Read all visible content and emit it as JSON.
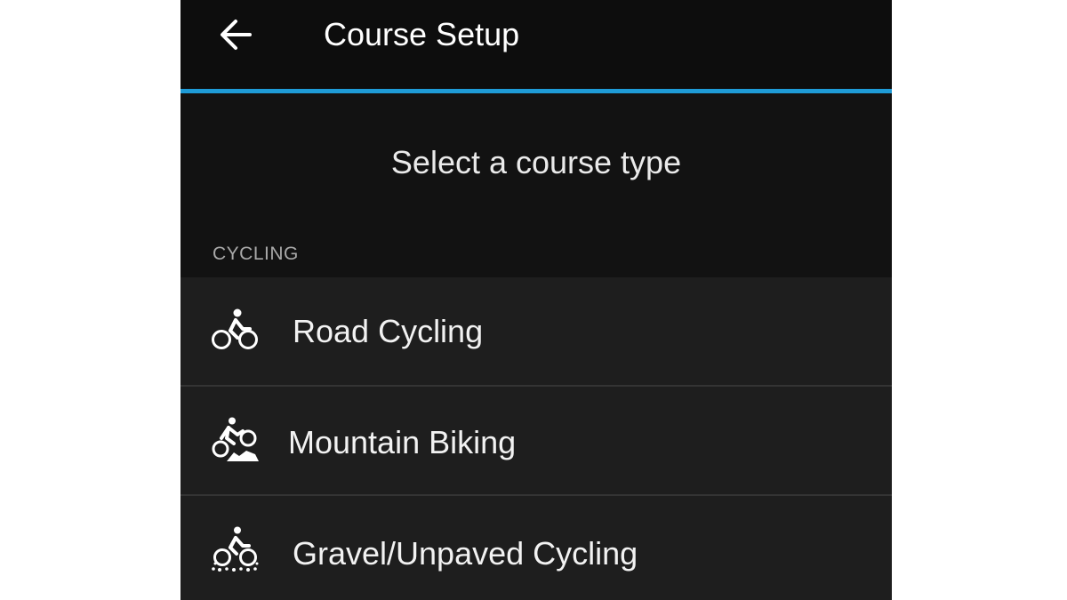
{
  "header": {
    "title": "Course Setup",
    "back_icon": "arrow-left-icon",
    "accent_color": "#1e9bd7"
  },
  "prompt": "Select a course type",
  "section": {
    "title": "CYCLING"
  },
  "course_types": [
    {
      "label": "Road Cycling",
      "icon": "road-cycling-icon"
    },
    {
      "label": "Mountain Biking",
      "icon": "mountain-biking-icon"
    },
    {
      "label": "Gravel/Unpaved Cycling",
      "icon": "gravel-cycling-icon"
    }
  ]
}
